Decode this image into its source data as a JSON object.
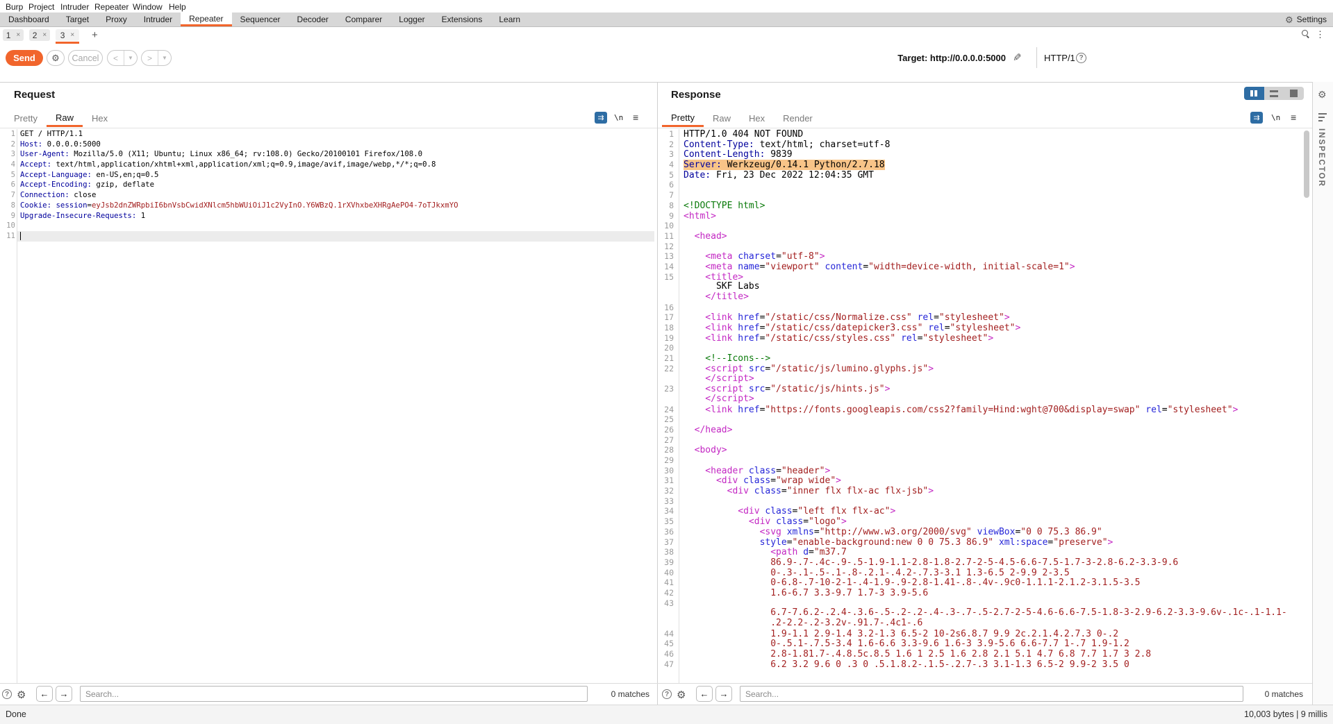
{
  "menubar": {
    "items": [
      "Burp",
      "Project",
      "Intruder",
      "Repeater",
      "Window",
      "Help"
    ],
    "item_x": [
      8,
      41,
      87,
      136,
      191,
      243
    ]
  },
  "main_tabs": {
    "items": [
      {
        "label": "Dashboard",
        "selected": false
      },
      {
        "label": "Target",
        "selected": false
      },
      {
        "label": "Proxy",
        "selected": false
      },
      {
        "label": "Intruder",
        "selected": false
      },
      {
        "label": "Repeater",
        "selected": true
      },
      {
        "label": "Sequencer",
        "selected": false
      },
      {
        "label": "Decoder",
        "selected": false
      },
      {
        "label": "Comparer",
        "selected": false
      },
      {
        "label": "Logger",
        "selected": false
      },
      {
        "label": "Extensions",
        "selected": false
      },
      {
        "label": "Learn",
        "selected": false
      }
    ],
    "settings_label": "Settings"
  },
  "repeater_tabs": {
    "items": [
      {
        "label": "1",
        "close": "×",
        "selected": false
      },
      {
        "label": "2",
        "close": "×",
        "selected": false
      },
      {
        "label": "3",
        "close": "×",
        "selected": true
      }
    ],
    "add_glyph": "+"
  },
  "toolbar": {
    "send_label": "Send",
    "cancel_label": "Cancel",
    "back_glyph": "<",
    "forward_glyph": ">",
    "dropdown_glyph": "▼",
    "target_label": "Target: http://0.0.0.0:5000",
    "http_version": "HTTP/1"
  },
  "request_panel": {
    "title": "Request",
    "tabs": [
      {
        "label": "Pretty",
        "selected": false
      },
      {
        "label": "Raw",
        "selected": true
      },
      {
        "label": "Hex",
        "selected": false
      }
    ],
    "newline_glyph": "\\n",
    "wrap_glyph": "⇉",
    "menu_glyph": "≡",
    "search": {
      "placeholder": "Search...",
      "matches": "0 matches"
    },
    "lines": [
      {
        "n": "1",
        "seg": [
          [
            "k",
            "GET / HTTP/1.1"
          ]
        ]
      },
      {
        "n": "2",
        "seg": [
          [
            "h",
            "Host:"
          ],
          [
            "k",
            " 0.0.0.0:5000"
          ]
        ]
      },
      {
        "n": "3",
        "seg": [
          [
            "h",
            "User-Agent:"
          ],
          [
            "k",
            " Mozilla/5.0 (X11; Ubuntu; Linux x86_64; rv:108.0) Gecko/20100101 Firefox/108.0"
          ]
        ]
      },
      {
        "n": "4",
        "seg": [
          [
            "h",
            "Accept:"
          ],
          [
            "k",
            " text/html,application/xhtml+xml,application/xml;q=0.9,image/avif,image/webp,*/*;q=0.8"
          ]
        ]
      },
      {
        "n": "5",
        "seg": [
          [
            "h",
            "Accept-Language:"
          ],
          [
            "k",
            " en-US,en;q=0.5"
          ]
        ]
      },
      {
        "n": "6",
        "seg": [
          [
            "h",
            "Accept-Encoding:"
          ],
          [
            "k",
            " gzip, deflate"
          ]
        ]
      },
      {
        "n": "7",
        "seg": [
          [
            "h",
            "Connection:"
          ],
          [
            "k",
            " close"
          ]
        ]
      },
      {
        "n": "8",
        "seg": [
          [
            "h",
            "Cookie:"
          ],
          [
            "k",
            " "
          ],
          [
            "h",
            "session"
          ],
          [
            "k",
            "="
          ],
          [
            "v",
            "eyJsb2dnZWRpbiI6bnVsbCwidXNlcm5hbWUiOiJ1c2VyInO.Y6WBzQ.1rXVhxbeXHRgAePO4-7oTJkxmYO"
          ]
        ]
      },
      {
        "n": "9",
        "seg": [
          [
            "h",
            "Upgrade-Insecure-Requests:"
          ],
          [
            "k",
            " 1"
          ]
        ]
      },
      {
        "n": "10",
        "seg": []
      },
      {
        "n": "11",
        "seg": []
      }
    ]
  },
  "response_panel": {
    "title": "Response",
    "tabs": [
      {
        "label": "Pretty",
        "selected": true
      },
      {
        "label": "Raw",
        "selected": false
      },
      {
        "label": "Hex",
        "selected": false
      },
      {
        "label": "Render",
        "selected": false
      }
    ],
    "newline_glyph": "\\n",
    "wrap_glyph": "⇉",
    "menu_glyph": "≡",
    "search": {
      "placeholder": "Search...",
      "matches": "0 matches"
    },
    "lines": [
      {
        "n": "1",
        "seg": [
          [
            "k",
            "HTTP/1.0 404 NOT FOUND"
          ]
        ]
      },
      {
        "n": "2",
        "seg": [
          [
            "h",
            "Content-Type:"
          ],
          [
            "k",
            " text/html; charset=utf-8"
          ]
        ]
      },
      {
        "n": "3",
        "seg": [
          [
            "h",
            "Content-Length:"
          ],
          [
            "k",
            " 9839"
          ]
        ]
      },
      {
        "n": "4",
        "hl": true,
        "seg": [
          [
            "h",
            "Server:"
          ],
          [
            "k",
            " Werkzeug/0.14.1 Python/2.7.18"
          ]
        ]
      },
      {
        "n": "5",
        "seg": [
          [
            "h",
            "Date:"
          ],
          [
            "k",
            " Fri, 23 Dec 2022 12:04:35 GMT"
          ]
        ]
      },
      {
        "n": "6",
        "seg": []
      },
      {
        "n": "7",
        "seg": []
      },
      {
        "n": "8",
        "seg": [
          [
            "g",
            "<!DOCTYPE html>"
          ]
        ]
      },
      {
        "n": "9",
        "seg": [
          [
            "t",
            "<html>"
          ]
        ]
      },
      {
        "n": "10",
        "seg": []
      },
      {
        "n": "11",
        "seg": [
          [
            "t",
            "  <head>"
          ]
        ]
      },
      {
        "n": "12",
        "seg": []
      },
      {
        "n": "13",
        "seg": [
          [
            "t",
            "    <meta "
          ],
          [
            "a",
            "charset"
          ],
          [
            "k",
            "="
          ],
          [
            "v",
            "\"utf-8\""
          ],
          [
            "t",
            ">"
          ]
        ]
      },
      {
        "n": "14",
        "seg": [
          [
            "t",
            "    <meta "
          ],
          [
            "a",
            "name"
          ],
          [
            "k",
            "="
          ],
          [
            "v",
            "\"viewport\""
          ],
          [
            "k",
            " "
          ],
          [
            "a",
            "content"
          ],
          [
            "k",
            "="
          ],
          [
            "v",
            "\"width=device-width, initial-scale=1\""
          ],
          [
            "t",
            ">"
          ]
        ]
      },
      {
        "n": "15",
        "seg": [
          [
            "t",
            "    <title>"
          ]
        ]
      },
      {
        "n": "",
        "seg": [
          [
            "k",
            "      SKF Labs"
          ]
        ]
      },
      {
        "n": "",
        "seg": [
          [
            "t",
            "    </title>"
          ]
        ]
      },
      {
        "n": "16",
        "seg": []
      },
      {
        "n": "17",
        "seg": [
          [
            "t",
            "    <link "
          ],
          [
            "a",
            "href"
          ],
          [
            "k",
            "="
          ],
          [
            "v",
            "\"/static/css/Normalize.css\""
          ],
          [
            "k",
            " "
          ],
          [
            "a",
            "rel"
          ],
          [
            "k",
            "="
          ],
          [
            "v",
            "\"stylesheet\""
          ],
          [
            "t",
            ">"
          ]
        ]
      },
      {
        "n": "18",
        "seg": [
          [
            "t",
            "    <link "
          ],
          [
            "a",
            "href"
          ],
          [
            "k",
            "="
          ],
          [
            "v",
            "\"/static/css/datepicker3.css\""
          ],
          [
            "k",
            " "
          ],
          [
            "a",
            "rel"
          ],
          [
            "k",
            "="
          ],
          [
            "v",
            "\"stylesheet\""
          ],
          [
            "t",
            ">"
          ]
        ]
      },
      {
        "n": "19",
        "seg": [
          [
            "t",
            "    <link "
          ],
          [
            "a",
            "href"
          ],
          [
            "k",
            "="
          ],
          [
            "v",
            "\"/static/css/styles.css\""
          ],
          [
            "k",
            " "
          ],
          [
            "a",
            "rel"
          ],
          [
            "k",
            "="
          ],
          [
            "v",
            "\"stylesheet\""
          ],
          [
            "t",
            ">"
          ]
        ]
      },
      {
        "n": "20",
        "seg": []
      },
      {
        "n": "21",
        "seg": [
          [
            "g",
            "    <!--Icons-->"
          ]
        ]
      },
      {
        "n": "22",
        "seg": [
          [
            "t",
            "    <script "
          ],
          [
            "a",
            "src"
          ],
          [
            "k",
            "="
          ],
          [
            "v",
            "\"/static/js/lumino.glyphs.js\""
          ],
          [
            "t",
            ">"
          ]
        ]
      },
      {
        "n": "",
        "seg": [
          [
            "t",
            "    </script>"
          ]
        ]
      },
      {
        "n": "23",
        "seg": [
          [
            "t",
            "    <script "
          ],
          [
            "a",
            "src"
          ],
          [
            "k",
            "="
          ],
          [
            "v",
            "\"/static/js/hints.js\""
          ],
          [
            "t",
            ">"
          ]
        ]
      },
      {
        "n": "",
        "seg": [
          [
            "t",
            "    </script>"
          ]
        ]
      },
      {
        "n": "24",
        "seg": [
          [
            "t",
            "    <link "
          ],
          [
            "a",
            "href"
          ],
          [
            "k",
            "="
          ],
          [
            "v",
            "\"https://fonts.googleapis.com/css2?family=Hind:wght@700&display=swap\""
          ],
          [
            "k",
            " "
          ],
          [
            "a",
            "rel"
          ],
          [
            "k",
            "="
          ],
          [
            "v",
            "\"stylesheet\""
          ],
          [
            "t",
            ">"
          ]
        ]
      },
      {
        "n": "25",
        "seg": []
      },
      {
        "n": "26",
        "seg": [
          [
            "t",
            "  </head>"
          ]
        ]
      },
      {
        "n": "27",
        "seg": []
      },
      {
        "n": "28",
        "seg": [
          [
            "t",
            "  <body>"
          ]
        ]
      },
      {
        "n": "29",
        "seg": []
      },
      {
        "n": "30",
        "seg": [
          [
            "t",
            "    <header "
          ],
          [
            "a",
            "class"
          ],
          [
            "k",
            "="
          ],
          [
            "v",
            "\"header\""
          ],
          [
            "t",
            ">"
          ]
        ]
      },
      {
        "n": "31",
        "seg": [
          [
            "t",
            "      <div "
          ],
          [
            "a",
            "class"
          ],
          [
            "k",
            "="
          ],
          [
            "v",
            "\"wrap wide\""
          ],
          [
            "t",
            ">"
          ]
        ]
      },
      {
        "n": "32",
        "seg": [
          [
            "t",
            "        <div "
          ],
          [
            "a",
            "class"
          ],
          [
            "k",
            "="
          ],
          [
            "v",
            "\"inner flx flx-ac flx-jsb\""
          ],
          [
            "t",
            ">"
          ]
        ]
      },
      {
        "n": "33",
        "seg": []
      },
      {
        "n": "34",
        "seg": [
          [
            "t",
            "          <div "
          ],
          [
            "a",
            "class"
          ],
          [
            "k",
            "="
          ],
          [
            "v",
            "\"left flx flx-ac\""
          ],
          [
            "t",
            ">"
          ]
        ]
      },
      {
        "n": "35",
        "seg": [
          [
            "t",
            "            <div "
          ],
          [
            "a",
            "class"
          ],
          [
            "k",
            "="
          ],
          [
            "v",
            "\"logo\""
          ],
          [
            "t",
            ">"
          ]
        ]
      },
      {
        "n": "36",
        "seg": [
          [
            "t",
            "              <svg "
          ],
          [
            "a",
            "xmlns"
          ],
          [
            "k",
            "="
          ],
          [
            "v",
            "\"http://www.w3.org/2000/svg\""
          ],
          [
            "k",
            " "
          ],
          [
            "a",
            "viewBox"
          ],
          [
            "k",
            "="
          ],
          [
            "v",
            "\"0 0 75.3 86.9\""
          ]
        ]
      },
      {
        "n": "37",
        "seg": [
          [
            "k",
            "              "
          ],
          [
            "a",
            "style"
          ],
          [
            "k",
            "="
          ],
          [
            "v",
            "\"enable-background:new 0 0 75.3 86.9\""
          ],
          [
            "k",
            " "
          ],
          [
            "a",
            "xml:space"
          ],
          [
            "k",
            "="
          ],
          [
            "v",
            "\"preserve\""
          ],
          [
            "t",
            ">"
          ]
        ]
      },
      {
        "n": "38",
        "seg": [
          [
            "t",
            "                <path "
          ],
          [
            "a",
            "d"
          ],
          [
            "k",
            "="
          ],
          [
            "v",
            "\"m37.7"
          ]
        ]
      },
      {
        "n": "39",
        "seg": [
          [
            "v",
            "                86.9-.7-.4c-.9-.5-1.9-1.1-2.8-1.8-2.7-2-5-4.5-6.6-7.5-1.7-3-2.8-6.2-3.3-9.6"
          ]
        ]
      },
      {
        "n": "40",
        "seg": [
          [
            "v",
            "                0-.3-.1-.5-.1-.8-.2.1-.4.2-.7.3-3.1 1.3-6.5 2-9.9 2-3.5"
          ]
        ]
      },
      {
        "n": "41",
        "seg": [
          [
            "v",
            "                0-6.8-.7-10-2-1-.4-1.9-.9-2.8-1.41-.8-.4v-.9c0-1.1.1-2.1.2-3.1.5-3.5"
          ]
        ]
      },
      {
        "n": "42",
        "seg": [
          [
            "v",
            "                1.6-6.7 3.3-9.7 1.7-3 3.9-5.6"
          ]
        ]
      },
      {
        "n": "43",
        "seg": []
      },
      {
        "n": "",
        "seg": [
          [
            "v",
            "                6.7-7.6.2-.2.4-.3.6-.5-.2-.2-.4-.3-.7-.5-2.7-2-5-4.6-6.6-7.5-1.8-3-2.9-6.2-3.3-9.6v-.1c-.1-1.1-"
          ]
        ]
      },
      {
        "n": "",
        "seg": [
          [
            "v",
            "                .2-2.2-.2-3.2v-.91.7-.4c1-.6"
          ]
        ]
      },
      {
        "n": "44",
        "seg": [
          [
            "v",
            "                1.9-1.1 2.9-1.4 3.2-1.3 6.5-2 10-2s6.8.7 9.9 2c.2.1.4.2.7.3 0-.2"
          ]
        ]
      },
      {
        "n": "45",
        "seg": [
          [
            "v",
            "                0-.5.1-.7.5-3.4 1.6-6.6 3.3-9.6 1.6-3 3.9-5.6 6.6-7.7 1-.7 1.9-1.2"
          ]
        ]
      },
      {
        "n": "46",
        "seg": [
          [
            "v",
            "                2.8-1.81.7-.4.8.5c.8.5 1.6 1 2.5 1.6 2.8 2.1 5.1 4.7 6.8 7.7 1.7 3 2.8"
          ]
        ]
      },
      {
        "n": "47",
        "seg": [
          [
            "v",
            "                6.2 3.2 9.6 0 .3 0 .5.1.8.2-.1.5-.2.7-.3 3.1-1.3 6.5-2 9.9-2 3.5 0"
          ]
        ]
      }
    ]
  },
  "inspector": {
    "label": "INSPECTOR"
  },
  "status_bar": {
    "left": "Done",
    "right": "10,003 bytes | 9 millis"
  }
}
